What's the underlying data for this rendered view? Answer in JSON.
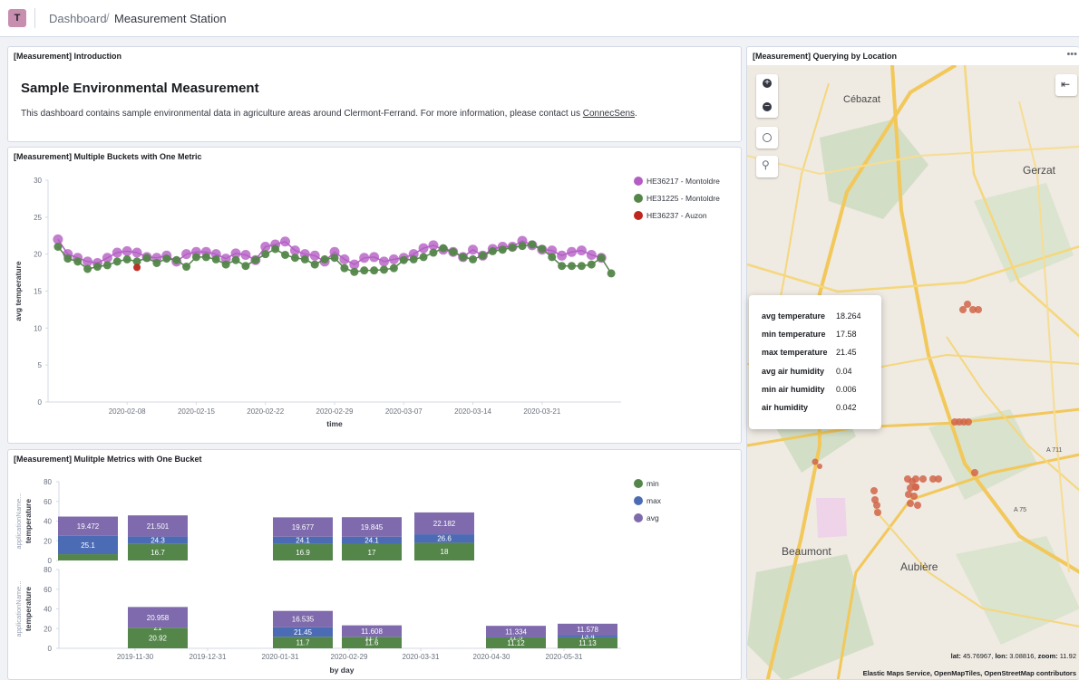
{
  "header": {
    "avatar_letter": "T",
    "breadcrumb_root": "Dashboard",
    "breadcrumb_sep": "/",
    "breadcrumb_current": "Measurement Station"
  },
  "intro": {
    "panel_title": "[Measurement] Introduction",
    "heading": "Sample Environmental Measurement",
    "body_text": "This dashboard contains sample environmental data in agriculture areas around Clermont-Ferrand. For more information, please contact us ",
    "link_text": "ConnecSens",
    "body_end": "."
  },
  "line_panel": {
    "panel_title": "[Measurement] Multiple Buckets with One Metric",
    "chart_data": {
      "type": "line",
      "xlabel": "time",
      "ylabel": "avg temperature",
      "ylim": [
        0,
        30
      ],
      "yticks": [
        "0",
        "5",
        "10",
        "15",
        "20",
        "25",
        "30"
      ],
      "xticks": [
        "2020-02-08",
        "2020-02-15",
        "2020-02-22",
        "2020-02-29",
        "2020-03-07",
        "2020-03-14",
        "2020-03-21"
      ],
      "legend_position": "right",
      "series": [
        {
          "name": "HE36217 - Montoldre",
          "color": "#b45ec4",
          "x": [
            "2020-02-01",
            "2020-02-02",
            "2020-02-03",
            "2020-02-04",
            "2020-02-05",
            "2020-02-06",
            "2020-02-07",
            "2020-02-08",
            "2020-02-09",
            "2020-02-10",
            "2020-02-11",
            "2020-02-12",
            "2020-02-13",
            "2020-02-14",
            "2020-02-15",
            "2020-02-16",
            "2020-02-17",
            "2020-02-18",
            "2020-02-19",
            "2020-02-20",
            "2020-02-21",
            "2020-02-22",
            "2020-02-23",
            "2020-02-24",
            "2020-02-25",
            "2020-02-26",
            "2020-02-27",
            "2020-02-28",
            "2020-02-29",
            "2020-03-01",
            "2020-03-02",
            "2020-03-03",
            "2020-03-04",
            "2020-03-05",
            "2020-03-06",
            "2020-03-07",
            "2020-03-08",
            "2020-03-09",
            "2020-03-10",
            "2020-03-11",
            "2020-03-12",
            "2020-03-13",
            "2020-03-14",
            "2020-03-15",
            "2020-03-16",
            "2020-03-17",
            "2020-03-18",
            "2020-03-19",
            "2020-03-20",
            "2020-03-21",
            "2020-03-22",
            "2020-03-23",
            "2020-03-24",
            "2020-03-25",
            "2020-03-26",
            "2020-03-27"
          ],
          "values": [
            22.0,
            20.0,
            19.5,
            19.0,
            18.8,
            19.5,
            20.2,
            20.4,
            20.2,
            19.6,
            19.5,
            19.8,
            19.0,
            20.0,
            20.3,
            20.3,
            20.0,
            19.4,
            20.1,
            19.9,
            19.2,
            21.0,
            21.3,
            21.7,
            20.5,
            20.0,
            19.8,
            19.0,
            20.3,
            19.3,
            18.6,
            19.5,
            19.6,
            19.0,
            19.3,
            19.5,
            20.0,
            20.8,
            21.2,
            20.6,
            20.3,
            19.6,
            20.6,
            19.8,
            20.7,
            21.0,
            21.0,
            21.8,
            21.2,
            20.6,
            20.5,
            19.8,
            20.3,
            20.5,
            19.9,
            19.5
          ]
        },
        {
          "name": "HE31225 - Montoldre",
          "color": "#54864a",
          "x": [
            "2020-02-01",
            "2020-02-02",
            "2020-02-03",
            "2020-02-04",
            "2020-02-05",
            "2020-02-06",
            "2020-02-07",
            "2020-02-08",
            "2020-02-09",
            "2020-02-10",
            "2020-02-11",
            "2020-02-12",
            "2020-02-13",
            "2020-02-14",
            "2020-02-15",
            "2020-02-16",
            "2020-02-17",
            "2020-02-18",
            "2020-02-19",
            "2020-02-20",
            "2020-02-21",
            "2020-02-22",
            "2020-02-23",
            "2020-02-24",
            "2020-02-25",
            "2020-02-26",
            "2020-02-27",
            "2020-02-28",
            "2020-02-29",
            "2020-03-01",
            "2020-03-02",
            "2020-03-03",
            "2020-03-04",
            "2020-03-05",
            "2020-03-06",
            "2020-03-07",
            "2020-03-08",
            "2020-03-09",
            "2020-03-10",
            "2020-03-11",
            "2020-03-12",
            "2020-03-13",
            "2020-03-14",
            "2020-03-15",
            "2020-03-16",
            "2020-03-17",
            "2020-03-18",
            "2020-03-19",
            "2020-03-20",
            "2020-03-21",
            "2020-03-22",
            "2020-03-23",
            "2020-03-24",
            "2020-03-25",
            "2020-03-26",
            "2020-03-27",
            "2020-03-28"
          ],
          "values": [
            21.0,
            19.4,
            19.0,
            18.0,
            18.3,
            18.5,
            19.0,
            19.3,
            19.0,
            19.5,
            18.8,
            19.4,
            19.2,
            18.3,
            19.6,
            19.6,
            19.3,
            18.6,
            19.2,
            18.4,
            19.2,
            20.0,
            20.7,
            19.9,
            19.5,
            19.3,
            18.6,
            19.3,
            19.5,
            18.1,
            17.6,
            17.8,
            17.8,
            17.9,
            18.1,
            19.2,
            19.3,
            19.6,
            20.2,
            20.8,
            20.3,
            19.6,
            19.3,
            19.8,
            20.4,
            20.6,
            20.9,
            21.1,
            21.3,
            20.7,
            19.6,
            18.4,
            18.4,
            18.4,
            18.6,
            19.5,
            17.4
          ]
        },
        {
          "name": "HE36237 - Auzon",
          "color": "#bd271e",
          "x": [
            "2020-02-09"
          ],
          "values": [
            18.2
          ]
        }
      ]
    }
  },
  "bar_panel": {
    "panel_title": "[Measurement] Mulitple Metrics with One Bucket",
    "chart_data": {
      "type": "bar",
      "stacked": true,
      "xlabel": "by day",
      "ylabel": "temperature",
      "row_label": "applicationName...",
      "ylim": [
        0,
        80
      ],
      "yticks": [
        "0",
        "20",
        "40",
        "60",
        "80"
      ],
      "xticks": [
        "2019-11-30",
        "2019-12-31",
        "2020-01-31",
        "2020-02-29",
        "2020-03-31",
        "2020-04-30",
        "2020-05-31"
      ],
      "legend_position": "right",
      "legend": [
        {
          "name": "min",
          "color": "#54864a"
        },
        {
          "name": "max",
          "color": "#4c6bb5"
        },
        {
          "name": "avg",
          "color": "#7e6aac"
        }
      ],
      "rows": [
        {
          "bars": [
            {
              "min_label": "",
              "min": 6.4,
              "max": 25.1,
              "avg": 19.472
            },
            {
              "min": 16.7,
              "max": 24.3,
              "avg": 21.501
            },
            {
              "min": 16.9,
              "max": 24.1,
              "avg": 19.677
            },
            {
              "min": 17,
              "max": 24.1,
              "avg": 19.845
            },
            {
              "min": 18,
              "max": 26.6,
              "avg": 22.182
            }
          ]
        },
        {
          "bars": [
            {
              "min": 20.92,
              "max": 21,
              "avg": 20.958
            },
            {
              "min": 11.7,
              "max": 21.45,
              "avg": 16.535
            },
            {
              "min": 11.6,
              "max": 11.7,
              "avg": 11.608
            },
            {
              "min": 11.12,
              "max": 11.5,
              "avg": 11.334
            },
            {
              "min": 11.13,
              "max": 13.4,
              "avg": 11.578
            }
          ]
        }
      ],
      "labels": {
        "r0": [
          [
            "",
            "25.1",
            "19.472"
          ],
          [
            "16.7",
            "24.3",
            "21.501"
          ],
          [
            "16.9",
            "24.1",
            "19.677"
          ],
          [
            "17",
            "24.1",
            "19.845"
          ],
          [
            "18",
            "26.6",
            "22.182"
          ]
        ],
        "r1": [
          [
            "20.92",
            "21",
            "20.958"
          ],
          [
            "11.7",
            "21.45",
            "16.535"
          ],
          [
            "11.6",
            "11.7",
            "11.608"
          ],
          [
            "11.12",
            "11.5",
            "11.334"
          ],
          [
            "11.13",
            "13.4",
            "11.578"
          ]
        ]
      }
    }
  },
  "map_panel": {
    "panel_title": "[Measurement] Querying by Location",
    "menu_icon": "ellipsis-icon",
    "places": [
      "Cébazat",
      "Gerzat",
      "Beaumont",
      "Aubière",
      "A 711",
      "A 75"
    ],
    "tooltip": [
      {
        "k": "avg temperature",
        "v": "18.264"
      },
      {
        "k": "min temperature",
        "v": "17.58"
      },
      {
        "k": "max temperature",
        "v": "21.45"
      },
      {
        "k": "avg air humidity",
        "v": "0.04"
      },
      {
        "k": "min air humidity",
        "v": "0.006"
      },
      {
        "k": "air humidity",
        "v": "0.042"
      }
    ],
    "coords_lat_label": "lat:",
    "coords_lat": "45.76967",
    "coords_lon_label": "lon:",
    "coords_lon": "3.08816",
    "coords_zoom_label": "zoom:",
    "coords_zoom": "11.92",
    "attribution": "Elastic Maps Service, OpenMapTiles, OpenStreetMap contributors"
  }
}
